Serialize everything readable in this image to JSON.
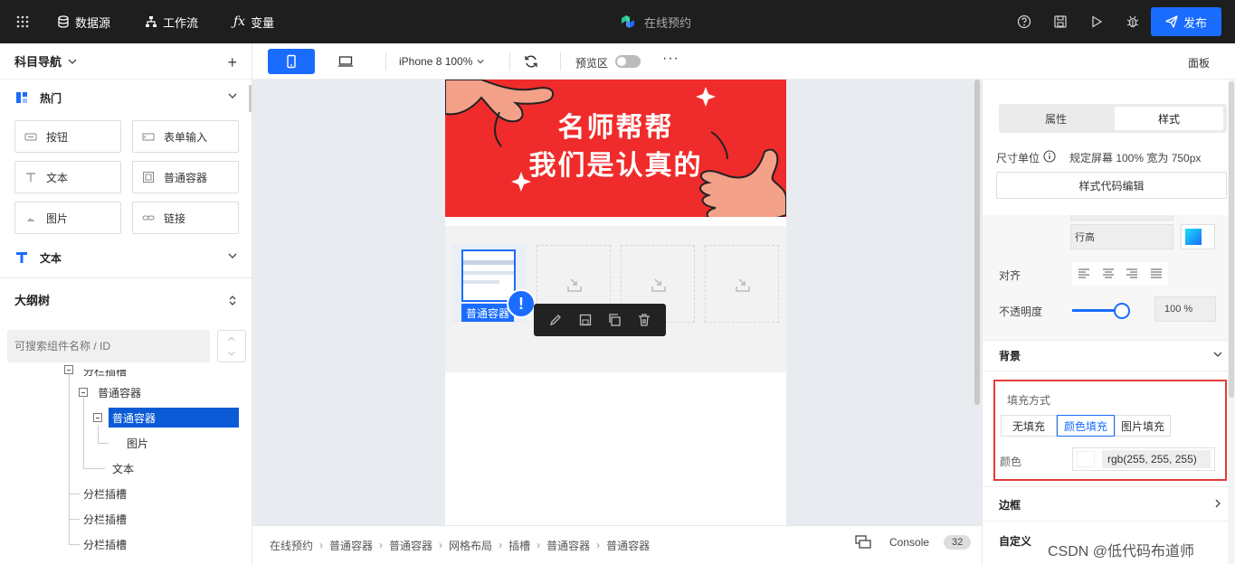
{
  "topbar": {
    "nav": [
      "数据源",
      "工作流",
      "变量"
    ],
    "title": "在线预约",
    "publish_label": "发布",
    "icons": [
      "grid-icon",
      "help-icon",
      "save-icon",
      "play-icon",
      "bug-icon",
      "send-icon"
    ]
  },
  "left_panel": {
    "title": "科目导航",
    "sections": {
      "hot": "热门",
      "text": "文本"
    },
    "components": [
      "按钮",
      "表单输入",
      "文本",
      "普通容器",
      "图片",
      "链接"
    ],
    "outline_title": "大纲树",
    "search_placeholder": "可搜索组件名称 / ID",
    "tree": [
      "分栏插槽",
      "普通容器",
      "普通容器",
      "图片",
      "文本",
      "分栏插槽",
      "分栏插槽",
      "分栏插槽"
    ]
  },
  "toolbar": {
    "device": "iPhone 8 100%",
    "preview_label": "预览区",
    "panel_label": "面板"
  },
  "canvas": {
    "banner_line1": "名师帮帮",
    "banner_line2": "我们是认真的",
    "selected_label": "普通容器",
    "warn_mark": "!"
  },
  "breadcrumb": [
    "在线预约",
    "普通容器",
    "普通容器",
    "网格布局",
    "插槽",
    "普通容器",
    "普通容器"
  ],
  "console": {
    "label": "Console",
    "count": "32"
  },
  "right_panel": {
    "tabs": [
      "属性",
      "样式"
    ],
    "size_unit_label": "尺寸单位",
    "size_unit_value": "规定屏幕 100% 宽为 750px",
    "code_edit_btn": "样式代码编辑",
    "line_height_label": "行高",
    "align_label": "对齐",
    "opacity_label": "不透明度",
    "opacity_value": "100 %",
    "opacity_level_percent": 100,
    "background_label": "背景",
    "fill_mode_label": "填充方式",
    "fill_options": [
      "无填充",
      "颜色填充",
      "图片填充"
    ],
    "color_label": "颜色",
    "color_value": "rgb(255, 255, 255)",
    "border_label": "边框",
    "custom_label": "自定义"
  },
  "watermark": "CSDN @低代码布道师",
  "colors": {
    "accent": "#1a6cff",
    "banner": "#f02b2b",
    "topbar": "#1e1e1e",
    "highlight_border": "#e23b3b"
  }
}
